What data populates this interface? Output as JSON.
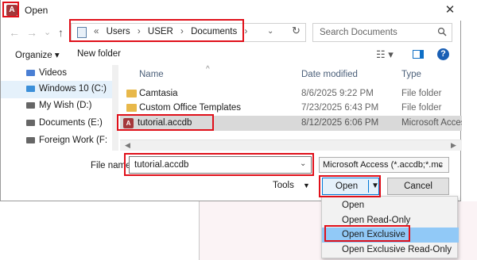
{
  "window": {
    "title": "Open",
    "logo": "A",
    "close_glyph": "✕"
  },
  "nav_buttons": {
    "back": "←",
    "forward": "→",
    "recent": "⌄",
    "up": "↑"
  },
  "address": {
    "breadcrumbs": [
      "«",
      "Users",
      "›",
      "USER",
      "›",
      "Documents",
      "›"
    ],
    "dropdown": "⌄",
    "refresh": "↻"
  },
  "search": {
    "placeholder": "Search Documents"
  },
  "toolbar": {
    "organize": "Organize ▾",
    "new_folder": "New folder",
    "view": "☷ ▾",
    "help": "?"
  },
  "nav_pane": {
    "items": [
      {
        "label": "Videos",
        "selected": false
      },
      {
        "label": "Windows 10 (C:)",
        "selected": true
      },
      {
        "label": "My Wish (D:)",
        "selected": false
      },
      {
        "label": "Documents (E:)",
        "selected": false
      },
      {
        "label": "Foreign Work (F:",
        "selected": false
      }
    ]
  },
  "file_list": {
    "sort_arrow": "^",
    "columns": [
      "Name",
      "Date modified",
      "Type"
    ],
    "rows": [
      {
        "icon": "folder-icon",
        "name": "Camtasia",
        "date": "8/6/2025 9:22 PM",
        "type": "File folder"
      },
      {
        "icon": "folder-icon",
        "name": "Custom Office Templates",
        "date": "7/23/2025 6:43 PM",
        "type": "File folder"
      },
      {
        "icon": "access-file-icon",
        "name": "tutorial.accdb",
        "date": "8/12/2025 6:06 PM",
        "type": "Microsoft Acces",
        "selected": true
      }
    ]
  },
  "file_name": {
    "label": "File name:",
    "value": "tutorial.accdb"
  },
  "file_type": {
    "value": "Microsoft Access (*.accdb;*.mc"
  },
  "actions": {
    "tools": "Tools",
    "open": "Open",
    "cancel": "Cancel"
  },
  "open_menu": {
    "items": [
      "Open",
      "Open Read-Only",
      "Open Exclusive",
      "Open Exclusive Read-Only"
    ],
    "highlighted_index": 2
  },
  "colors": {
    "accent": "#0078d7",
    "highlight": "#e0101a",
    "selection": "#91c9f7"
  }
}
